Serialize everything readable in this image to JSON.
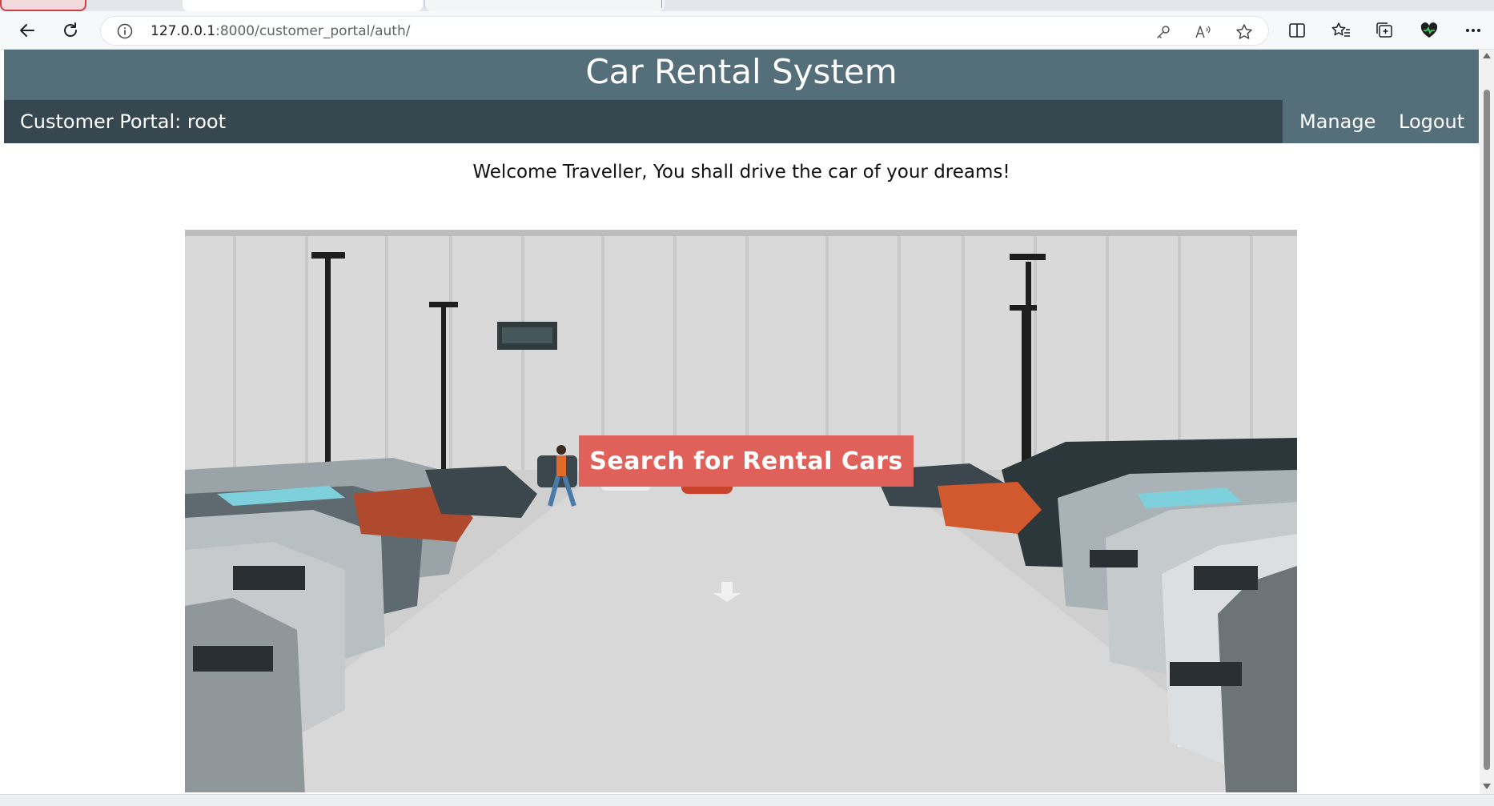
{
  "browser": {
    "url_host": "127.0.0.1",
    "url_path": ":8000/customer_portal/auth/"
  },
  "site": {
    "title": "Car Rental System",
    "header_color": "#546e7a",
    "navbar_color": "#37474f"
  },
  "navbar": {
    "brand": "Customer Portal: root",
    "links": [
      {
        "label": "Manage"
      },
      {
        "label": "Logout"
      }
    ]
  },
  "main": {
    "welcome": "Welcome Traveller, You shall drive the car of your dreams!",
    "cta_label": "Search for Rental Cars",
    "cta_color": "#e0605a",
    "hero_alt": "parking-lot-photo"
  },
  "icons": {
    "back": "back-arrow-icon",
    "reload": "reload-icon",
    "info": "site-info-icon",
    "key": "password-key-icon",
    "read_aloud": "read-aloud-icon",
    "favorite": "favorite-star-icon",
    "split": "split-screen-icon",
    "favorites": "favorites-icon",
    "collections": "collections-icon",
    "health": "browser-essentials-icon",
    "more": "more-options-icon"
  }
}
